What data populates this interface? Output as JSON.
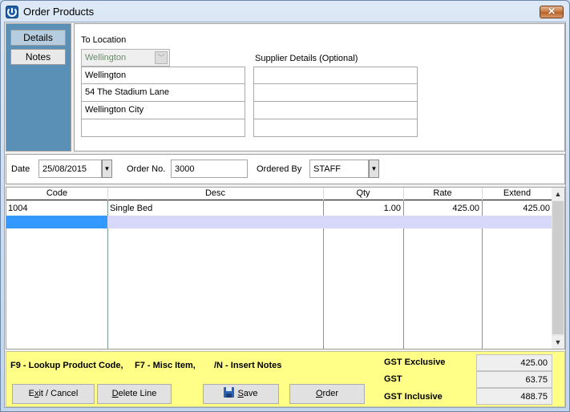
{
  "window": {
    "title": "Order Products",
    "close_label": "✕"
  },
  "sidebar": {
    "items": [
      {
        "label": "Details",
        "active": true
      },
      {
        "label": "Notes",
        "active": false
      }
    ]
  },
  "location": {
    "label": "To Location",
    "selected": "Wellington",
    "address": [
      "Wellington",
      "54 The Stadium Lane",
      "Wellington City",
      ""
    ]
  },
  "supplier": {
    "label": "Supplier Details (Optional)",
    "address": [
      "",
      "",
      "",
      ""
    ]
  },
  "order": {
    "date_label": "Date",
    "date_value": "25/08/2015",
    "order_no_label": "Order No.",
    "order_no_value": "3000",
    "ordered_by_label": "Ordered By",
    "ordered_by_value": "STAFF",
    "dropdown_arrow": "▼"
  },
  "grid": {
    "columns": [
      "Code",
      "Desc",
      "Qty",
      "Rate",
      "Extend"
    ],
    "rows": [
      {
        "code": "1004",
        "desc": "Single Bed",
        "qty": "1.00",
        "rate": "425.00",
        "extend": "425.00"
      }
    ],
    "scroll_up": "▲",
    "scroll_down": "▼"
  },
  "footer": {
    "hints": [
      "F9 - Lookup Product Code,",
      "F7 - Misc Item,",
      "/N - Insert Notes"
    ],
    "buttons": {
      "exit": {
        "pre": "E",
        "key": "x",
        "post": "it / Cancel"
      },
      "delete": {
        "pre": "",
        "key": "D",
        "post": "elete Line"
      },
      "save": {
        "pre": "",
        "key": "S",
        "post": "ave"
      },
      "order": {
        "pre": "",
        "key": "O",
        "post": "rder"
      }
    },
    "totals": [
      {
        "label": "GST Exclusive",
        "value": "425.00"
      },
      {
        "label": "GST",
        "value": "63.75"
      },
      {
        "label": "GST Inclusive",
        "value": "488.75"
      }
    ]
  },
  "colors": {
    "sidebar_bg": "#5a8fb6",
    "footer_bg": "#ffff88",
    "selected_row": "#3399ff",
    "row_highlight": "#d8d8fa"
  }
}
